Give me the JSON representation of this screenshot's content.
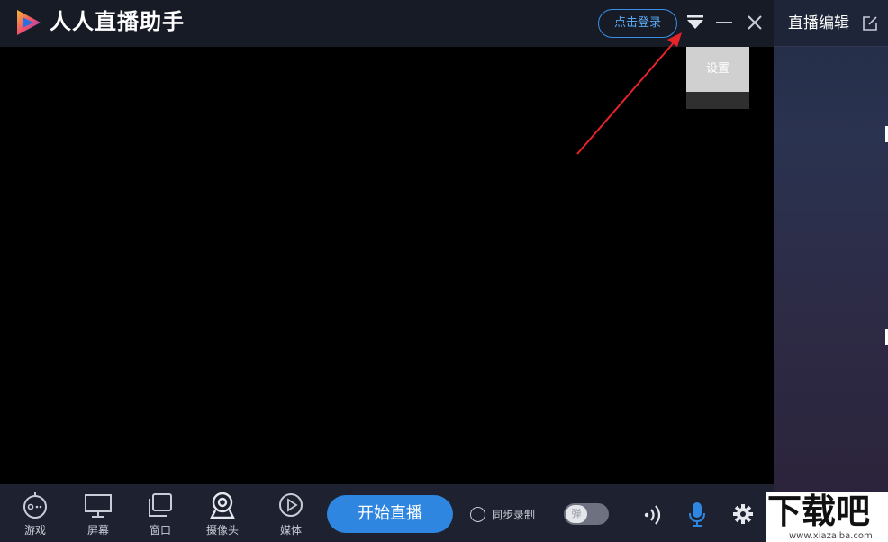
{
  "app": {
    "title": "人人直播助手",
    "logo_icon": "play-triangle-logo",
    "login_label": "点击登录",
    "dropdown_icon": "triangle-down-icon",
    "minimize_icon": "minimize-icon",
    "close_icon": "close-icon"
  },
  "menu": {
    "items": [
      {
        "label": "设置"
      }
    ]
  },
  "sidebar": {
    "title": "直播编辑",
    "edit_icon": "edit-icon"
  },
  "toolbar": {
    "sources": [
      {
        "label": "游戏",
        "icon": "gamepad-icon"
      },
      {
        "label": "屏幕",
        "icon": "monitor-icon"
      },
      {
        "label": "窗口",
        "icon": "window-icon"
      },
      {
        "label": "摄像头",
        "icon": "webcam-icon"
      },
      {
        "label": "媒体",
        "icon": "play-circle-icon"
      }
    ],
    "start_label": "开始直播",
    "sync_record_label": "同步录制",
    "danmu_toggle_label": "弹",
    "speaker_icon": "speaker-icon",
    "mic_icon": "microphone-icon",
    "settings_icon": "gear-icon"
  },
  "colors": {
    "accent": "#2f86e0",
    "titlebar": "#171b26",
    "toolbar": "#1d2130",
    "mic": "#2f86e0",
    "annotation_arrow": "#e8242b"
  },
  "watermark": {
    "text": "下载吧",
    "url": "www.xiazaiba.com"
  }
}
